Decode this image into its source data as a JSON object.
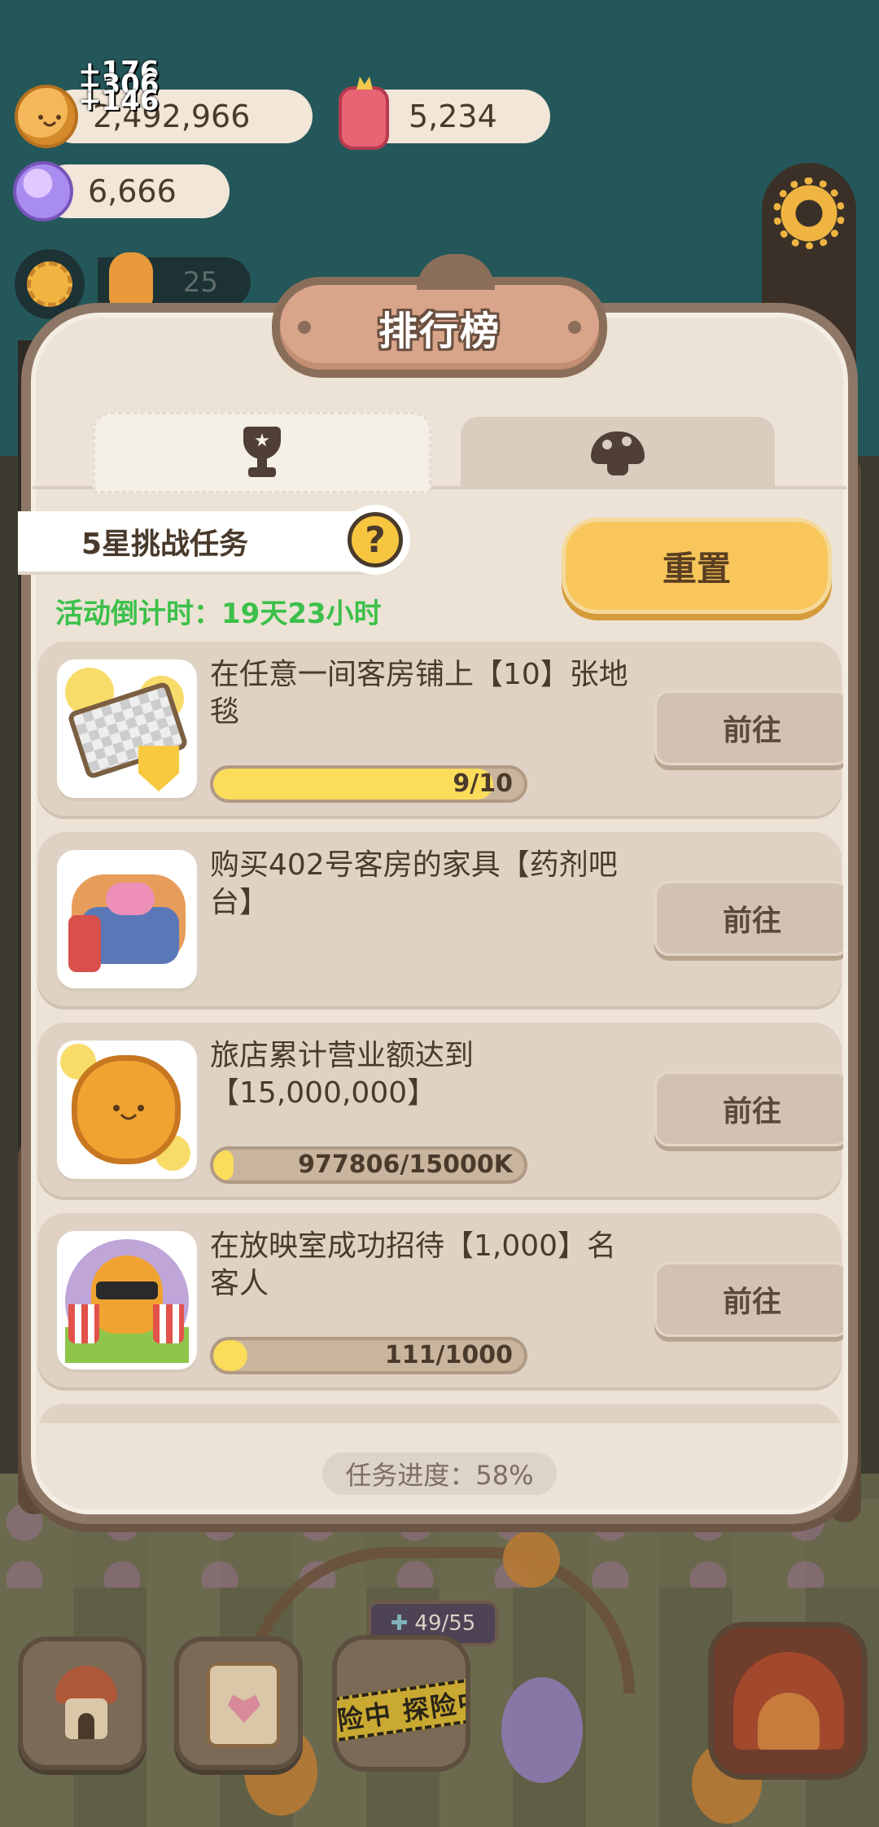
{
  "hud": {
    "coins": "2,492,966",
    "coin_gain_lines": [
      "+176",
      "+306",
      "+146"
    ],
    "cakes": "5,234",
    "candies": "6,666",
    "staff_count": "25"
  },
  "modal": {
    "title": "排行榜",
    "tabs": [
      {
        "icon": "trophy-icon",
        "active": true
      },
      {
        "icon": "mushroom-icon",
        "active": false
      }
    ],
    "challenge_label": "5星挑战任务",
    "help": "?",
    "reset_label": "重置",
    "countdown": "活动倒计时：19天23小时",
    "tasks": [
      {
        "title": "在任意一间客房铺上【10】张地毯",
        "progress_text": "9/10",
        "progress": 0.9,
        "button": "前往",
        "thumb": "rug"
      },
      {
        "title": "购买402号客房的家具【药剂吧台】",
        "progress_text": "",
        "progress": null,
        "button": "前往",
        "thumb": "potion-bar"
      },
      {
        "title": "旅店累计营业额达到【15,000,000】",
        "progress_text": "977806/15000K",
        "progress": 0.065,
        "button": "前往",
        "thumb": "coin-cookie"
      },
      {
        "title": "在放映室成功招待【1,000】名客人",
        "progress_text": "111/1000",
        "progress": 0.111,
        "button": "前往",
        "thumb": "cinema"
      }
    ],
    "overall_progress": "任务进度：58%"
  },
  "bottom": {
    "energy": "49/55",
    "explore_label": "险中 探险中"
  },
  "colors": {
    "accent_yellow": "#f8c65a",
    "countdown_green": "#3cc04a",
    "modal_bg": "#ece3d6",
    "frame_brown": "#8e7766"
  }
}
